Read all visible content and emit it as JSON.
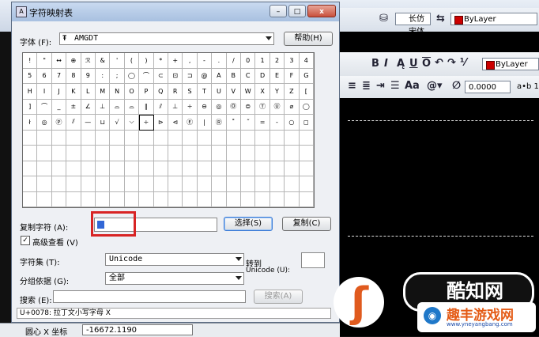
{
  "dialog": {
    "title": "字符映射表",
    "window_buttons": {
      "minimize": "–",
      "maximize": "□",
      "close": "x"
    },
    "font_label": "字体 (F):",
    "font_value": "AMGDT",
    "help_button": "帮助(H)",
    "grid_rows": [
      [
        "!",
        "\"",
        "↔",
        "⊕",
        "ℛ",
        "&",
        "'",
        "(",
        ")",
        "*",
        "+",
        ",",
        "-",
        ".",
        "/",
        "0",
        "1",
        "2",
        "3",
        "4"
      ],
      [
        "5",
        "6",
        "7",
        "8",
        "9",
        ":",
        ";",
        "◯",
        "⌒",
        "⊂",
        "⊡",
        "⊐",
        "@",
        "A",
        "B",
        "C",
        "D",
        "E",
        "F",
        "G"
      ],
      [
        "H",
        "I",
        "J",
        "K",
        "L",
        "M",
        "N",
        "O",
        "P",
        "Q",
        "R",
        "S",
        "T",
        "U",
        "V",
        "W",
        "X",
        "Y",
        "Z",
        "["
      ],
      [
        "]",
        "⌒",
        "_",
        "±",
        "∠",
        "⊥",
        "⌓",
        "⌓",
        "∥",
        "⫽",
        "⊥",
        "÷",
        "⊖",
        "◎",
        "Ⓞ",
        "⊜",
        "Ⓣ",
        "Ⓤ",
        "⌀",
        "◯"
      ],
      [
        "ł",
        "◎",
        "Ⓟ",
        "⫽",
        "—",
        "⊔",
        "√",
        "⌵",
        "÷",
        "⊳",
        "⊲",
        "Ⓔ",
        "|",
        "Ⓡ",
        "˚",
        "˝",
        "=",
        "-",
        "○",
        "◻"
      ],
      [
        "",
        "",
        "",
        "",
        "",
        "",
        "",
        "",
        "",
        "",
        "",
        "",
        "",
        "",
        "",
        "",
        "",
        "",
        "",
        ""
      ],
      [
        "",
        "",
        "",
        "",
        "",
        "",
        "",
        "",
        "",
        "",
        "",
        "",
        "",
        "",
        "",
        "",
        "",
        "",
        "",
        ""
      ],
      [
        "",
        "",
        "",
        "",
        "",
        "",
        "",
        "",
        "",
        "",
        "",
        "",
        "",
        "",
        "",
        "",
        "",
        "",
        "",
        ""
      ],
      [
        "",
        "",
        "",
        "",
        "",
        "",
        "",
        "",
        "",
        "",
        "",
        "",
        "",
        "",
        "",
        "",
        "",
        "",
        "",
        ""
      ],
      [
        "",
        "",
        "",
        "",
        "",
        "",
        "",
        "",
        "",
        "",
        "",
        "",
        "",
        "",
        "",
        "",
        "",
        "",
        "",
        ""
      ]
    ],
    "copy_label": "复制字符 (A):",
    "copy_value": "",
    "select_button": "选择(S)",
    "copy_button": "复制(C)",
    "advanced_label": "高级查看 (V)",
    "advanced_checked": "✓",
    "charset_label": "字符集 (T):",
    "charset_value": "Unicode",
    "goto_label_1": "转到",
    "goto_label_2": "Unicode (U):",
    "group_label": "分组依据 (G):",
    "group_value": "全部",
    "search_label": "搜索 (E):",
    "search_button": "搜索(A)",
    "status": "U+0078: 拉丁文小写字母 X"
  },
  "cad": {
    "bylayer_top": "ByLayer",
    "font_top": "长仿宋体",
    "bylayer_mid": "ByLayer",
    "bold": "B",
    "italic": "I",
    "offset_value": "0.0000",
    "ab_label": "a•b 1",
    "center_x_label": "圆心 X 坐标",
    "center_x_value": "-16672.1190"
  },
  "watermark": {
    "badge_text": "酷知网",
    "site_title": "趣丰游戏网",
    "site_url": "www.yneyangbang.com"
  }
}
